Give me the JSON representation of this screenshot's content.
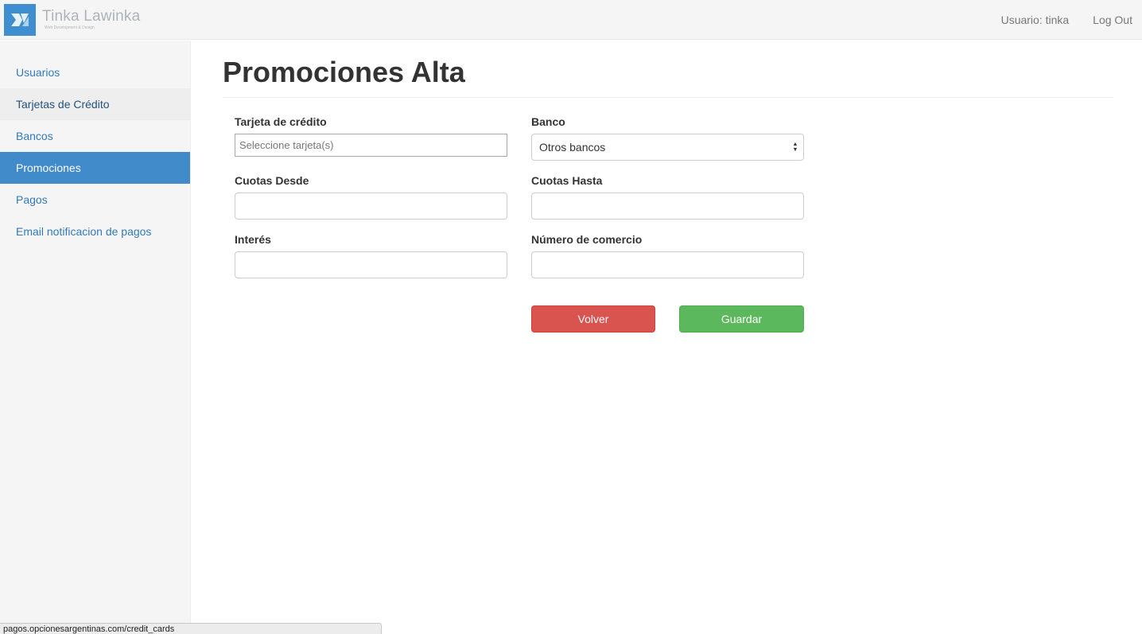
{
  "navbar": {
    "brand_name": "Tinka Lawinka",
    "brand_tagline": "Web Development & Design",
    "user_label": "Usuario: tinka",
    "logout_label": "Log Out"
  },
  "sidebar": {
    "items": [
      {
        "label": "Usuarios",
        "state": "normal"
      },
      {
        "label": "Tarjetas de Crédito",
        "state": "hover"
      },
      {
        "label": "Bancos",
        "state": "normal"
      },
      {
        "label": "Promociones",
        "state": "active"
      },
      {
        "label": "Pagos",
        "state": "normal"
      },
      {
        "label": "Email notificacion de pagos",
        "state": "normal"
      }
    ]
  },
  "page": {
    "title": "Promociones Alta"
  },
  "form": {
    "tarjeta": {
      "label": "Tarjeta de crédito",
      "placeholder": "Seleccione tarjeta(s)",
      "value": ""
    },
    "banco": {
      "label": "Banco",
      "selected": "Otros bancos"
    },
    "cuotas_desde": {
      "label": "Cuotas Desde",
      "value": ""
    },
    "cuotas_hasta": {
      "label": "Cuotas Hasta",
      "value": ""
    },
    "interes": {
      "label": "Interés",
      "value": ""
    },
    "numero_comercio": {
      "label": "Número de comercio",
      "value": ""
    },
    "volver_label": "Volver",
    "guardar_label": "Guardar"
  },
  "statusbar": {
    "url": "pagos.opcionesargentinas.com/credit_cards"
  },
  "colors": {
    "primary": "#428bca",
    "link": "#337ab7",
    "danger": "#d9534f",
    "success": "#5cb85c"
  }
}
